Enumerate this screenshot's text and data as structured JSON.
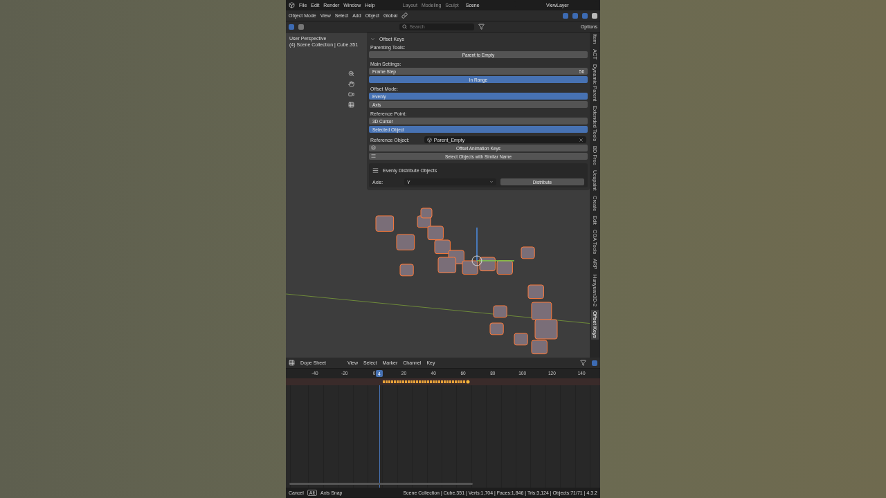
{
  "top_bar": {
    "menus": [
      "File",
      "Edit",
      "Render",
      "Window",
      "Help"
    ],
    "workspaces": [
      {
        "label": "Layout",
        "selected": false
      },
      {
        "label": "Modeling",
        "selected": false
      },
      {
        "label": "Sculpt",
        "selected": false
      }
    ],
    "scene": "Scene",
    "view_layer": "ViewLayer"
  },
  "viewport_header": {
    "mode": "Object Mode",
    "menus": [
      "View",
      "Select",
      "Add",
      "Object"
    ],
    "orientation": "Global"
  },
  "tool_header": {
    "search": {
      "placeholder": "Search"
    },
    "options": "Options"
  },
  "viewport": {
    "perspective": "User Perspective",
    "collection": "(4) Scene Collection | Cube.351"
  },
  "panel": {
    "title": "Offset Keys",
    "parenting_label": "Parenting Tools:",
    "parent_button": "Parent to Empty",
    "main_label": "Main Settings:",
    "frame_step": {
      "label": "Frame Step",
      "value": "56"
    },
    "in_range": {
      "label": "In Range",
      "on": true
    },
    "offset_mode": {
      "label": "Offset Mode:",
      "options": [
        {
          "label": "Evenly",
          "selected": true
        },
        {
          "label": "Axis",
          "selected": false
        }
      ]
    },
    "reference_point": {
      "label": "Reference Point:",
      "options": [
        {
          "label": "3D Cursor",
          "selected": false
        },
        {
          "label": "Selected Object",
          "selected": true
        }
      ]
    },
    "reference_object": {
      "label": "Reference Object:",
      "value": "Parent_Empty"
    },
    "actions": [
      {
        "kind": "keys",
        "label": "Offset Animation Keys"
      },
      {
        "kind": "sort",
        "label": "Select Objects with Similar Name"
      }
    ],
    "distribute": {
      "title": "Evenly Distribute Objects",
      "axis_label": "Axis:",
      "axis": "Y",
      "button": "Distribute"
    }
  },
  "sidebar_tabs": [
    {
      "label": "Item",
      "selected": false
    },
    {
      "label": "ACT",
      "selected": false
    },
    {
      "label": "Dynamic Parent",
      "selected": false
    },
    {
      "label": "Extended Tools",
      "selected": false
    },
    {
      "label": "BD Free",
      "selected": false
    },
    {
      "label": "Ucupaint",
      "selected": false
    },
    {
      "label": "Create",
      "selected": false
    },
    {
      "label": "Edit",
      "selected": false
    },
    {
      "label": "COA Tools",
      "selected": false
    },
    {
      "label": "ARP",
      "selected": false
    },
    {
      "label": "Hunyuan3D-2",
      "selected": false
    },
    {
      "label": "Offset Keys",
      "selected": true
    }
  ],
  "dope_sheet": {
    "editor": "Dope Sheet",
    "menus": [
      "View",
      "Select",
      "Marker",
      "Channel",
      "Key"
    ],
    "ticks": [
      "-40",
      "-20",
      "0",
      "20",
      "40",
      "60",
      "80",
      "100",
      "120",
      "140"
    ],
    "current_frame": "4"
  },
  "status_bar": {
    "cancel": "Cancel",
    "key": "Alt",
    "axis_snap": "Axis Snap",
    "stats": "Scene Collection | Cube.351 | Verts:1,704 | Faces:1,846 | Tris:3,124 | Objects:71/71 | 4.3.2"
  }
}
